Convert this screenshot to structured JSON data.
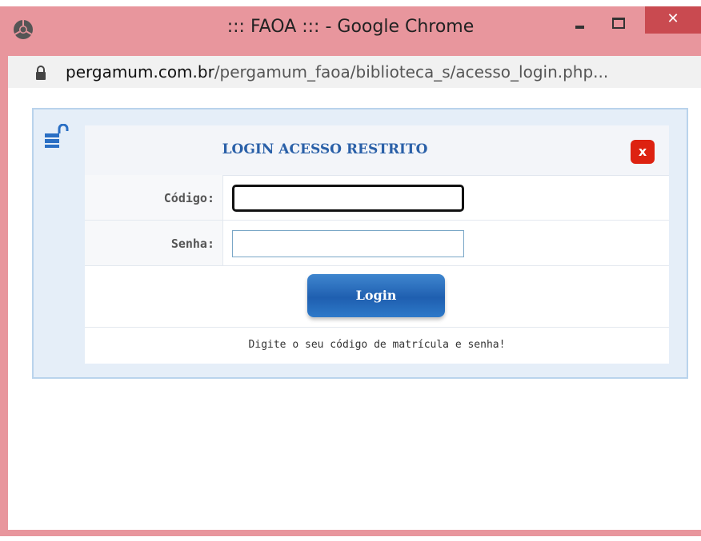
{
  "window": {
    "title": "::: FAOA ::: - Google Chrome",
    "close_label": "✕"
  },
  "address": {
    "host": "pergamum.com.br",
    "path": "/pergamum_faoa/biblioteca_s/acesso_login.php..."
  },
  "login": {
    "title": "LOGIN ACESSO RESTRITO",
    "close_label": "x",
    "codigo_label": "Código:",
    "codigo_value": "",
    "senha_label": "Senha:",
    "senha_value": "",
    "button_label": "Login",
    "hint": "Digite o seu código de matrícula e senha!"
  },
  "colors": {
    "window_frame": "#e8969d",
    "title_blue": "#2a60a8",
    "button_blue": "#1f5fb0",
    "close_red": "#dd2211"
  },
  "icons": [
    "chrome-logo-icon",
    "minimize-icon",
    "maximize-icon",
    "close-icon",
    "lock-icon",
    "unlock-icon"
  ]
}
